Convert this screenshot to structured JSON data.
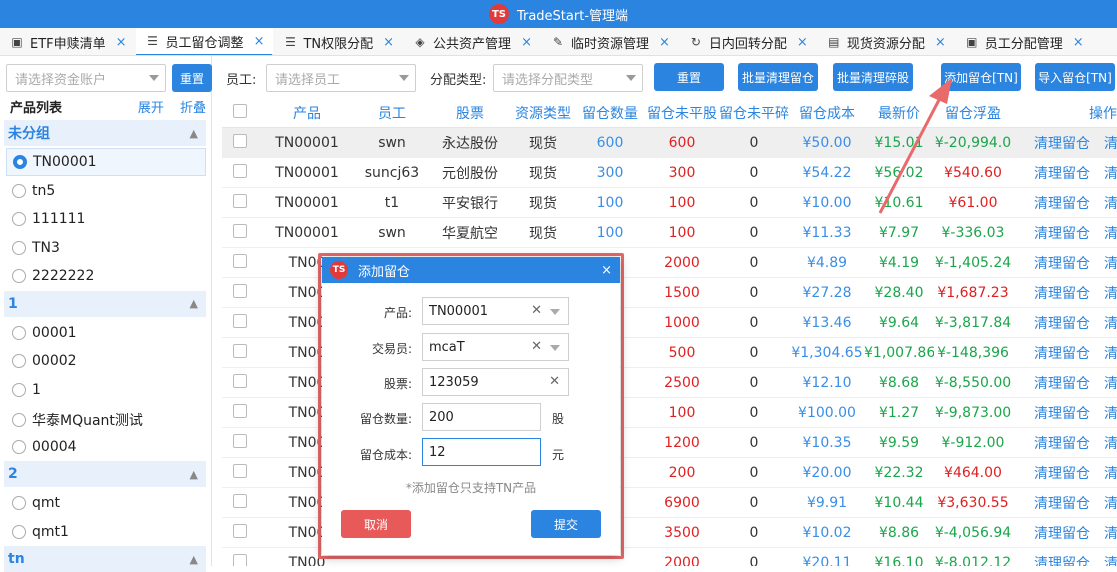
{
  "app": {
    "title": "TradeStart-管理端",
    "logo": "TS"
  },
  "tabs": [
    {
      "label": "ETF申赎清单",
      "icon": "id-card-icon"
    },
    {
      "label": "员工留仓调整",
      "icon": "sliders-icon"
    },
    {
      "label": "TN权限分配",
      "icon": "list-icon"
    },
    {
      "label": "公共资产管理",
      "icon": "layers-icon"
    },
    {
      "label": "临时资源管理",
      "icon": "edit-icon"
    },
    {
      "label": "日内回转分配",
      "icon": "refresh-icon"
    },
    {
      "label": "现货资源分配",
      "icon": "database-icon"
    },
    {
      "label": "员工分配管理",
      "icon": "badge-icon"
    }
  ],
  "left": {
    "account_placeholder": "请选择资金账户",
    "reset": "重置",
    "list_title": "产品列表",
    "expand": "展开",
    "collapse": "折叠",
    "groups": [
      {
        "name": "未分组",
        "items": [
          "TN00001",
          "tn5",
          "111111",
          "TN3",
          "2222222"
        ]
      },
      {
        "name": "1",
        "items": [
          "00001",
          "00002",
          "1",
          "华泰MQuant测试",
          "00004"
        ]
      },
      {
        "name": "2",
        "items": [
          "qmt",
          "qmt1"
        ]
      },
      {
        "name": "tn",
        "items": []
      }
    ]
  },
  "toolbar": {
    "employee_label": "员工:",
    "employee_placeholder": "请选择员工",
    "type_label": "分配类型:",
    "type_placeholder": "请选择分配类型",
    "reset": "重置",
    "batch_clear": "批量清理留仓",
    "batch_clear_frag": "批量清理碎股",
    "add": "添加留仓[TN]",
    "import": "导入留仓[TN]"
  },
  "table": {
    "headers": [
      "产品",
      "员工",
      "股票",
      "资源类型",
      "留仓数量",
      "留仓未平股",
      "留仓未平碎",
      "留仓成本",
      "最新价",
      "留仓浮盈",
      "操作"
    ],
    "action_label": "清理留仓",
    "action_label2": "清",
    "rows": [
      [
        "TN00001",
        "swn",
        "永达股份",
        "现货",
        "600",
        "600",
        "0",
        "¥50.00",
        "¥15.01",
        "¥-20,994.0"
      ],
      [
        "TN00001",
        "suncj63",
        "元创股份",
        "现货",
        "300",
        "300",
        "0",
        "¥54.22",
        "¥56.02",
        "¥540.60"
      ],
      [
        "TN00001",
        "t1",
        "平安银行",
        "现货",
        "100",
        "100",
        "0",
        "¥10.00",
        "¥10.61",
        "¥61.00"
      ],
      [
        "TN00001",
        "swn",
        "华夏航空",
        "现货",
        "100",
        "100",
        "0",
        "¥11.33",
        "¥7.97",
        "¥-336.03"
      ],
      [
        "TN00",
        "",
        "",
        "",
        "",
        "2000",
        "0",
        "¥4.89",
        "¥4.19",
        "¥-1,405.24"
      ],
      [
        "TN00",
        "",
        "",
        "",
        "",
        "1500",
        "0",
        "¥27.28",
        "¥28.40",
        "¥1,687.23"
      ],
      [
        "TN00",
        "",
        "",
        "",
        "",
        "1000",
        "0",
        "¥13.46",
        "¥9.64",
        "¥-3,817.84"
      ],
      [
        "TN00",
        "",
        "",
        "",
        "",
        "500",
        "0",
        "¥1,304.65",
        "¥1,007.86",
        "¥-148,396"
      ],
      [
        "TN00",
        "",
        "",
        "",
        "",
        "2500",
        "0",
        "¥12.10",
        "¥8.68",
        "¥-8,550.00"
      ],
      [
        "TN00",
        "",
        "",
        "",
        "",
        "100",
        "0",
        "¥100.00",
        "¥1.27",
        "¥-9,873.00"
      ],
      [
        "TN00",
        "",
        "",
        "",
        "",
        "1200",
        "0",
        "¥10.35",
        "¥9.59",
        "¥-912.00"
      ],
      [
        "TN00",
        "",
        "",
        "",
        "",
        "200",
        "0",
        "¥20.00",
        "¥22.32",
        "¥464.00"
      ],
      [
        "TN00",
        "",
        "",
        "",
        "",
        "6900",
        "0",
        "¥9.91",
        "¥10.44",
        "¥3,630.55"
      ],
      [
        "TN00",
        "",
        "",
        "",
        "",
        "3500",
        "0",
        "¥10.02",
        "¥8.86",
        "¥-4,056.94"
      ],
      [
        "TN00",
        "",
        "",
        "",
        "",
        "2000",
        "0",
        "¥20.11",
        "¥16.10",
        "¥-8,012.12"
      ]
    ]
  },
  "modal": {
    "title": "添加留仓",
    "logo": "TS",
    "close": "×",
    "product_label": "产品:",
    "product_value": "TN00001",
    "trader_label": "交易员:",
    "trader_value": "mcaT",
    "stock_label": "股票:",
    "stock_value": "123059",
    "qty_label": "留仓数量:",
    "qty_value": "200",
    "qty_unit": "股",
    "cost_label": "留仓成本:",
    "cost_value": "12",
    "cost_unit": "元",
    "note": "*添加留仓只支持TN产品",
    "cancel": "取消",
    "submit": "提交"
  },
  "colors": {
    "primary": "#2a84e0",
    "cancel": "#e85a5a",
    "positive": "#e02020",
    "negative": "#1aa64a",
    "highlight_border": "#e86a6a"
  }
}
